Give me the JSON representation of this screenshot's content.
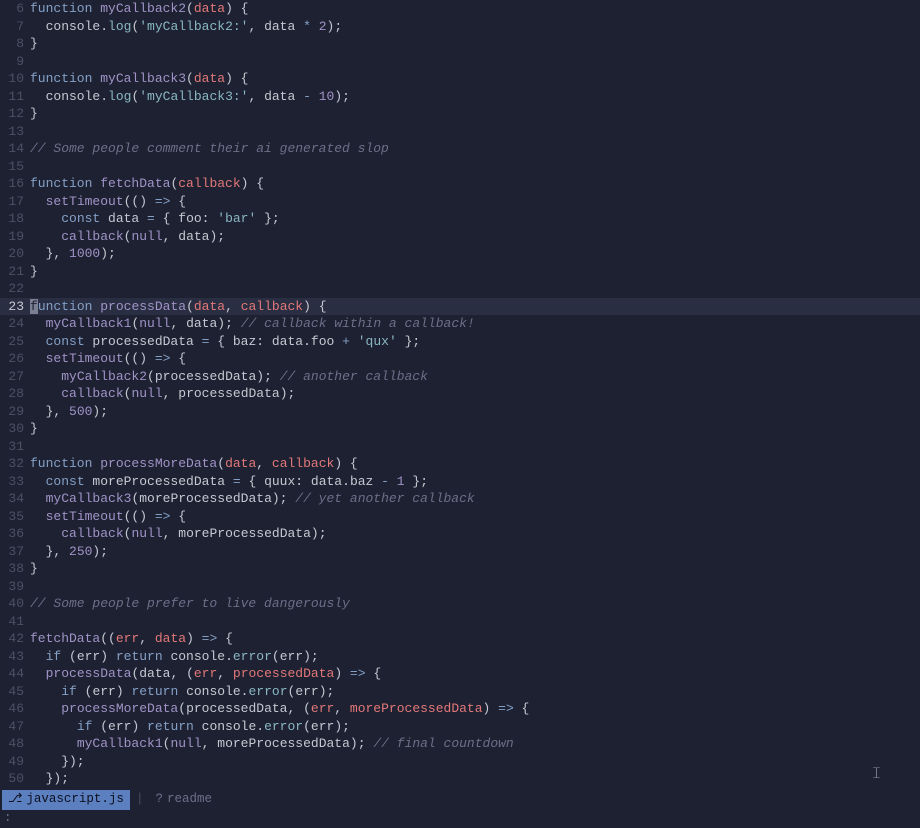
{
  "editor": {
    "current_line": 23,
    "lines": [
      {
        "n": 6,
        "tokens": [
          [
            "kw",
            "function "
          ],
          [
            "fn",
            "myCallback2"
          ],
          [
            "punc",
            "("
          ],
          [
            "param",
            "data"
          ],
          [
            "punc",
            ") {"
          ]
        ]
      },
      {
        "n": 7,
        "tokens": [
          [
            "id",
            "  console"
          ],
          [
            "punc",
            "."
          ],
          [
            "prop",
            "log"
          ],
          [
            "punc",
            "("
          ],
          [
            "str",
            "'myCallback2:'"
          ],
          [
            "punc",
            ", "
          ],
          [
            "id",
            "data "
          ],
          [
            "op",
            "*"
          ],
          [
            "punc",
            " "
          ],
          [
            "num",
            "2"
          ],
          [
            "punc",
            ");"
          ]
        ]
      },
      {
        "n": 8,
        "tokens": [
          [
            "punc",
            "}"
          ]
        ]
      },
      {
        "n": 9,
        "tokens": []
      },
      {
        "n": 10,
        "tokens": [
          [
            "kw",
            "function "
          ],
          [
            "fn",
            "myCallback3"
          ],
          [
            "punc",
            "("
          ],
          [
            "param",
            "data"
          ],
          [
            "punc",
            ") {"
          ]
        ]
      },
      {
        "n": 11,
        "tokens": [
          [
            "id",
            "  console"
          ],
          [
            "punc",
            "."
          ],
          [
            "prop",
            "log"
          ],
          [
            "punc",
            "("
          ],
          [
            "str",
            "'myCallback3:'"
          ],
          [
            "punc",
            ", "
          ],
          [
            "id",
            "data "
          ],
          [
            "op",
            "-"
          ],
          [
            "punc",
            " "
          ],
          [
            "num",
            "10"
          ],
          [
            "punc",
            ");"
          ]
        ]
      },
      {
        "n": 12,
        "tokens": [
          [
            "punc",
            "}"
          ]
        ]
      },
      {
        "n": 13,
        "tokens": []
      },
      {
        "n": 14,
        "tokens": [
          [
            "cmt",
            "// Some people comment their ai generated slop"
          ]
        ]
      },
      {
        "n": 15,
        "tokens": []
      },
      {
        "n": 16,
        "tokens": [
          [
            "kw",
            "function "
          ],
          [
            "fn",
            "fetchData"
          ],
          [
            "punc",
            "("
          ],
          [
            "param",
            "callback"
          ],
          [
            "punc",
            ") {"
          ]
        ]
      },
      {
        "n": 17,
        "tokens": [
          [
            "id",
            "  "
          ],
          [
            "fn",
            "setTimeout"
          ],
          [
            "punc",
            "(() "
          ],
          [
            "op",
            "=>"
          ],
          [
            "punc",
            " {"
          ]
        ]
      },
      {
        "n": 18,
        "tokens": [
          [
            "id",
            "    "
          ],
          [
            "kw",
            "const "
          ],
          [
            "id",
            "data "
          ],
          [
            "op",
            "="
          ],
          [
            "punc",
            " { "
          ],
          [
            "id",
            "foo"
          ],
          [
            "punc",
            ": "
          ],
          [
            "str",
            "'bar'"
          ],
          [
            "punc",
            " };"
          ]
        ]
      },
      {
        "n": 19,
        "tokens": [
          [
            "id",
            "    "
          ],
          [
            "fn",
            "callback"
          ],
          [
            "punc",
            "("
          ],
          [
            "null",
            "null"
          ],
          [
            "punc",
            ", "
          ],
          [
            "id",
            "data"
          ],
          [
            "punc",
            ");"
          ]
        ]
      },
      {
        "n": 20,
        "tokens": [
          [
            "punc",
            "  }, "
          ],
          [
            "num",
            "1000"
          ],
          [
            "punc",
            ");"
          ]
        ]
      },
      {
        "n": 21,
        "tokens": [
          [
            "punc",
            "}"
          ]
        ]
      },
      {
        "n": 22,
        "tokens": []
      },
      {
        "n": 23,
        "cursor_first": true,
        "tokens": [
          [
            "kw",
            "function "
          ],
          [
            "fn",
            "processData"
          ],
          [
            "punc",
            "("
          ],
          [
            "param",
            "data"
          ],
          [
            "punc",
            ", "
          ],
          [
            "param",
            "callback"
          ],
          [
            "punc",
            ") {"
          ]
        ]
      },
      {
        "n": 24,
        "tokens": [
          [
            "id",
            "  "
          ],
          [
            "fn",
            "myCallback1"
          ],
          [
            "punc",
            "("
          ],
          [
            "null",
            "null"
          ],
          [
            "punc",
            ", "
          ],
          [
            "id",
            "data"
          ],
          [
            "punc",
            "); "
          ],
          [
            "cmt",
            "// callback within a callback!"
          ]
        ]
      },
      {
        "n": 25,
        "tokens": [
          [
            "id",
            "  "
          ],
          [
            "kw",
            "const "
          ],
          [
            "id",
            "processedData "
          ],
          [
            "op",
            "="
          ],
          [
            "punc",
            " { "
          ],
          [
            "id",
            "baz"
          ],
          [
            "punc",
            ": "
          ],
          [
            "id",
            "data"
          ],
          [
            "punc",
            "."
          ],
          [
            "id",
            "foo "
          ],
          [
            "op",
            "+"
          ],
          [
            "punc",
            " "
          ],
          [
            "str",
            "'qux'"
          ],
          [
            "punc",
            " };"
          ]
        ]
      },
      {
        "n": 26,
        "tokens": [
          [
            "id",
            "  "
          ],
          [
            "fn",
            "setTimeout"
          ],
          [
            "punc",
            "(() "
          ],
          [
            "op",
            "=>"
          ],
          [
            "punc",
            " {"
          ]
        ]
      },
      {
        "n": 27,
        "tokens": [
          [
            "id",
            "    "
          ],
          [
            "fn",
            "myCallback2"
          ],
          [
            "punc",
            "("
          ],
          [
            "id",
            "processedData"
          ],
          [
            "punc",
            "); "
          ],
          [
            "cmt",
            "// another callback"
          ]
        ]
      },
      {
        "n": 28,
        "tokens": [
          [
            "id",
            "    "
          ],
          [
            "fn",
            "callback"
          ],
          [
            "punc",
            "("
          ],
          [
            "null",
            "null"
          ],
          [
            "punc",
            ", "
          ],
          [
            "id",
            "processedData"
          ],
          [
            "punc",
            ");"
          ]
        ]
      },
      {
        "n": 29,
        "tokens": [
          [
            "punc",
            "  }, "
          ],
          [
            "num",
            "500"
          ],
          [
            "punc",
            ");"
          ]
        ]
      },
      {
        "n": 30,
        "tokens": [
          [
            "punc",
            "}"
          ]
        ]
      },
      {
        "n": 31,
        "tokens": []
      },
      {
        "n": 32,
        "tokens": [
          [
            "kw",
            "function "
          ],
          [
            "fn",
            "processMoreData"
          ],
          [
            "punc",
            "("
          ],
          [
            "param",
            "data"
          ],
          [
            "punc",
            ", "
          ],
          [
            "param",
            "callback"
          ],
          [
            "punc",
            ") {"
          ]
        ]
      },
      {
        "n": 33,
        "tokens": [
          [
            "id",
            "  "
          ],
          [
            "kw",
            "const "
          ],
          [
            "id",
            "moreProcessedData "
          ],
          [
            "op",
            "="
          ],
          [
            "punc",
            " { "
          ],
          [
            "id",
            "quux"
          ],
          [
            "punc",
            ": "
          ],
          [
            "id",
            "data"
          ],
          [
            "punc",
            "."
          ],
          [
            "id",
            "baz "
          ],
          [
            "op",
            "-"
          ],
          [
            "punc",
            " "
          ],
          [
            "num",
            "1"
          ],
          [
            "punc",
            " };"
          ]
        ]
      },
      {
        "n": 34,
        "tokens": [
          [
            "id",
            "  "
          ],
          [
            "fn",
            "myCallback3"
          ],
          [
            "punc",
            "("
          ],
          [
            "id",
            "moreProcessedData"
          ],
          [
            "punc",
            "); "
          ],
          [
            "cmt",
            "// yet another callback"
          ]
        ]
      },
      {
        "n": 35,
        "tokens": [
          [
            "id",
            "  "
          ],
          [
            "fn",
            "setTimeout"
          ],
          [
            "punc",
            "(() "
          ],
          [
            "op",
            "=>"
          ],
          [
            "punc",
            " {"
          ]
        ]
      },
      {
        "n": 36,
        "tokens": [
          [
            "id",
            "    "
          ],
          [
            "fn",
            "callback"
          ],
          [
            "punc",
            "("
          ],
          [
            "null",
            "null"
          ],
          [
            "punc",
            ", "
          ],
          [
            "id",
            "moreProcessedData"
          ],
          [
            "punc",
            ");"
          ]
        ]
      },
      {
        "n": 37,
        "tokens": [
          [
            "punc",
            "  }, "
          ],
          [
            "num",
            "250"
          ],
          [
            "punc",
            ");"
          ]
        ]
      },
      {
        "n": 38,
        "tokens": [
          [
            "punc",
            "}"
          ]
        ]
      },
      {
        "n": 39,
        "tokens": []
      },
      {
        "n": 40,
        "tokens": [
          [
            "cmt",
            "// Some people prefer to live dangerously"
          ]
        ]
      },
      {
        "n": 41,
        "tokens": []
      },
      {
        "n": 42,
        "tokens": [
          [
            "fn",
            "fetchData"
          ],
          [
            "punc",
            "(("
          ],
          [
            "param",
            "err"
          ],
          [
            "punc",
            ", "
          ],
          [
            "param",
            "data"
          ],
          [
            "punc",
            ") "
          ],
          [
            "op",
            "=>"
          ],
          [
            "punc",
            " {"
          ]
        ]
      },
      {
        "n": 43,
        "tokens": [
          [
            "id",
            "  "
          ],
          [
            "kw",
            "if "
          ],
          [
            "punc",
            "("
          ],
          [
            "id",
            "err"
          ],
          [
            "punc",
            ") "
          ],
          [
            "kw",
            "return "
          ],
          [
            "id",
            "console"
          ],
          [
            "punc",
            "."
          ],
          [
            "prop",
            "error"
          ],
          [
            "punc",
            "("
          ],
          [
            "id",
            "err"
          ],
          [
            "punc",
            ");"
          ]
        ]
      },
      {
        "n": 44,
        "tokens": [
          [
            "id",
            "  "
          ],
          [
            "fn",
            "processData"
          ],
          [
            "punc",
            "("
          ],
          [
            "id",
            "data"
          ],
          [
            "punc",
            ", ("
          ],
          [
            "param",
            "err"
          ],
          [
            "punc",
            ", "
          ],
          [
            "param",
            "processedData"
          ],
          [
            "punc",
            ") "
          ],
          [
            "op",
            "=>"
          ],
          [
            "punc",
            " {"
          ]
        ]
      },
      {
        "n": 45,
        "tokens": [
          [
            "id",
            "    "
          ],
          [
            "kw",
            "if "
          ],
          [
            "punc",
            "("
          ],
          [
            "id",
            "err"
          ],
          [
            "punc",
            ") "
          ],
          [
            "kw",
            "return "
          ],
          [
            "id",
            "console"
          ],
          [
            "punc",
            "."
          ],
          [
            "prop",
            "error"
          ],
          [
            "punc",
            "("
          ],
          [
            "id",
            "err"
          ],
          [
            "punc",
            ");"
          ]
        ]
      },
      {
        "n": 46,
        "tokens": [
          [
            "id",
            "    "
          ],
          [
            "fn",
            "processMoreData"
          ],
          [
            "punc",
            "("
          ],
          [
            "id",
            "processedData"
          ],
          [
            "punc",
            ", ("
          ],
          [
            "param",
            "err"
          ],
          [
            "punc",
            ", "
          ],
          [
            "param",
            "moreProcessedData"
          ],
          [
            "punc",
            ") "
          ],
          [
            "op",
            "=>"
          ],
          [
            "punc",
            " {"
          ]
        ]
      },
      {
        "n": 47,
        "tokens": [
          [
            "id",
            "      "
          ],
          [
            "kw",
            "if "
          ],
          [
            "punc",
            "("
          ],
          [
            "id",
            "err"
          ],
          [
            "punc",
            ") "
          ],
          [
            "kw",
            "return "
          ],
          [
            "id",
            "console"
          ],
          [
            "punc",
            "."
          ],
          [
            "prop",
            "error"
          ],
          [
            "punc",
            "("
          ],
          [
            "id",
            "err"
          ],
          [
            "punc",
            ");"
          ]
        ]
      },
      {
        "n": 48,
        "tokens": [
          [
            "id",
            "      "
          ],
          [
            "fn",
            "myCallback1"
          ],
          [
            "punc",
            "("
          ],
          [
            "null",
            "null"
          ],
          [
            "punc",
            ", "
          ],
          [
            "id",
            "moreProcessedData"
          ],
          [
            "punc",
            "); "
          ],
          [
            "cmt",
            "// final countdown"
          ]
        ]
      },
      {
        "n": 49,
        "tokens": [
          [
            "punc",
            "    });"
          ]
        ]
      },
      {
        "n": 50,
        "tokens": [
          [
            "punc",
            "  });"
          ]
        ]
      }
    ]
  },
  "statusbar": {
    "active_tab_icon": "⎇",
    "active_tab": "javascript.js",
    "sep": "|",
    "inactive_tab_icon": "?",
    "inactive_tab": "readme"
  },
  "cmdline": ":",
  "mouse_ibeam": "𝙸"
}
